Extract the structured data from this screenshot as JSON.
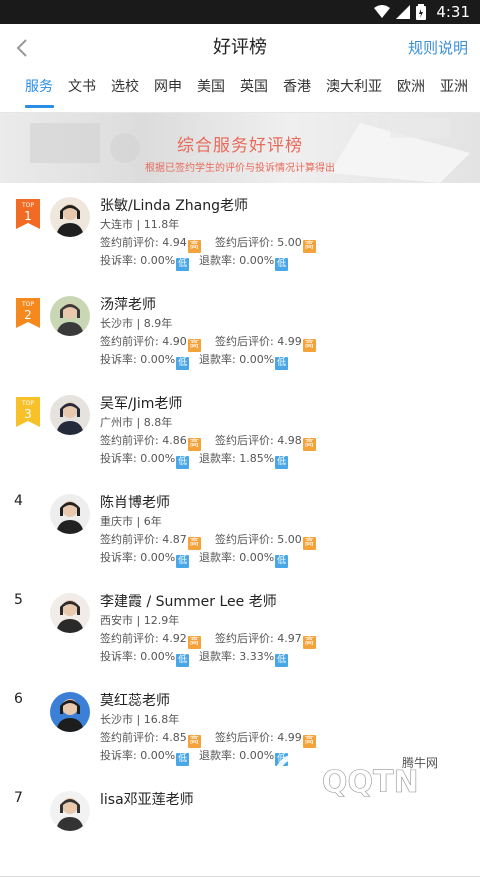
{
  "status": {
    "time": "4:31"
  },
  "header": {
    "title": "好评榜",
    "rules_label": "规则说明"
  },
  "tabs": [
    {
      "label": "服务",
      "active": true
    },
    {
      "label": "文书"
    },
    {
      "label": "选校"
    },
    {
      "label": "网申"
    },
    {
      "label": "美国"
    },
    {
      "label": "英国"
    },
    {
      "label": "香港"
    },
    {
      "label": "澳大利亚"
    },
    {
      "label": "欧洲"
    },
    {
      "label": "亚洲"
    }
  ],
  "banner": {
    "title": "综合服务好评榜",
    "subtitle": "根据已签约学生的评价与投诉情况计算得出"
  },
  "rows": [
    {
      "rank": "1",
      "top_label": "TOP",
      "flag_color": "#f26b25",
      "name": "张敏/Linda Zhang老师",
      "location": "大连市 | 11.8年",
      "pre_label": "签约前评价:",
      "pre": "4.94",
      "pre_badge": "高",
      "post_label": "签约后评价:",
      "post": "5.00",
      "post_badge": "高",
      "complaint_label": "投诉率:",
      "complaint": "0.00%",
      "complaint_badge": "低",
      "refund_label": "退款率:",
      "refund": "0.00%",
      "refund_badge": "低"
    },
    {
      "rank": "2",
      "top_label": "TOP",
      "flag_color": "#f5891d",
      "name": "汤萍老师",
      "location": "长沙市 | 8.9年",
      "pre_label": "签约前评价:",
      "pre": "4.90",
      "pre_badge": "高",
      "post_label": "签约后评价:",
      "post": "4.99",
      "post_badge": "高",
      "complaint_label": "投诉率:",
      "complaint": "0.00%",
      "complaint_badge": "低",
      "refund_label": "退款率:",
      "refund": "0.00%",
      "refund_badge": "低"
    },
    {
      "rank": "3",
      "top_label": "TOP",
      "flag_color": "#f7c12a",
      "name": "吴军/Jim老师",
      "location": "广州市 | 8.8年",
      "pre_label": "签约前评价:",
      "pre": "4.86",
      "pre_badge": "高",
      "post_label": "签约后评价:",
      "post": "4.98",
      "post_badge": "高",
      "complaint_label": "投诉率:",
      "complaint": "0.00%",
      "complaint_badge": "低",
      "refund_label": "退款率:",
      "refund": "1.85%",
      "refund_badge": "低"
    },
    {
      "rank": "4",
      "name": "陈肖博老师",
      "location": "重庆市 | 6年",
      "pre_label": "签约前评价:",
      "pre": "4.87",
      "pre_badge": "高",
      "post_label": "签约后评价:",
      "post": "5.00",
      "post_badge": "高",
      "complaint_label": "投诉率:",
      "complaint": "0.00%",
      "complaint_badge": "低",
      "refund_label": "退款率:",
      "refund": "0.00%",
      "refund_badge": "低"
    },
    {
      "rank": "5",
      "name": "李建霞 / Summer Lee 老师",
      "location": "西安市 | 12.9年",
      "pre_label": "签约前评价:",
      "pre": "4.92",
      "pre_badge": "高",
      "post_label": "签约后评价:",
      "post": "4.97",
      "post_badge": "高",
      "complaint_label": "投诉率:",
      "complaint": "0.00%",
      "complaint_badge": "低",
      "refund_label": "退款率:",
      "refund": "3.33%",
      "refund_badge": "低"
    },
    {
      "rank": "6",
      "name": "莫红蕊老师",
      "location": "长沙市 | 16.8年",
      "pre_label": "签约前评价:",
      "pre": "4.85",
      "pre_badge": "高",
      "post_label": "签约后评价:",
      "post": "4.99",
      "post_badge": "高",
      "complaint_label": "投诉率:",
      "complaint": "0.00%",
      "complaint_badge": "低",
      "refund_label": "退款率:",
      "refund": "0.00%",
      "refund_badge": "低"
    },
    {
      "rank": "7",
      "name": "lisa邓亚莲老师",
      "location": "",
      "pre_label": "",
      "pre": "",
      "pre_badge": "",
      "post_label": "",
      "post": "",
      "post_badge": "",
      "complaint_label": "",
      "complaint": "",
      "complaint_badge": "",
      "refund_label": "",
      "refund": "",
      "refund_badge": ""
    }
  ],
  "watermark": {
    "brand": "腾牛网",
    "logo": "QQTN.com"
  }
}
